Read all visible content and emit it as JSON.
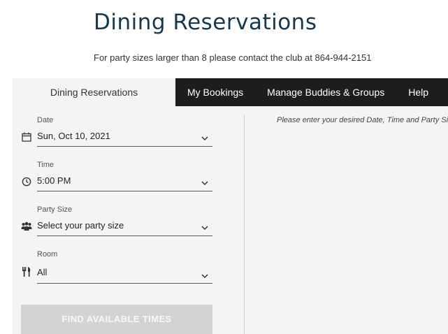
{
  "page": {
    "title": "Dining Reservations",
    "notice": "For party sizes larger than 8 please contact the club at 864-944-2151"
  },
  "tabs": [
    {
      "label": "Dining Reservations",
      "active": true
    },
    {
      "label": "My Bookings",
      "active": false
    },
    {
      "label": "Manage Buddies & Groups",
      "active": false
    },
    {
      "label": "Help",
      "active": false
    }
  ],
  "form": {
    "date": {
      "label": "Date",
      "value": "Sun, Oct 10, 2021",
      "icon": "calendar-icon"
    },
    "time": {
      "label": "Time",
      "value": "5:00 PM",
      "icon": "clock-icon"
    },
    "party_size": {
      "label": "Party Size",
      "value": "Select your party size",
      "icon": "people-icon"
    },
    "room": {
      "label": "Room",
      "value": "All",
      "icon": "utensils-icon"
    },
    "find_button": "FIND AVAILABLE TIMES"
  },
  "results": {
    "hint": "Please enter your desired Date, Time and Party Size"
  },
  "colors": {
    "title": "#15384f",
    "tabbar": "#1d1d1d",
    "panel": "#f4f4f4",
    "button_disabled": "#d3d3d3"
  }
}
